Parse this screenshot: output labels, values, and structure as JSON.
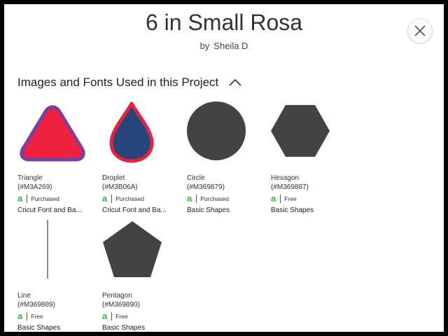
{
  "project": {
    "title": "6 in Small Rosa",
    "by_label": "by",
    "author": "Sheila D"
  },
  "section": {
    "title": "Images and Fonts Used in this Project"
  },
  "icons": {
    "close": "close-icon",
    "collapse": "chevron-up-icon",
    "brand": "cricut-access-icon"
  },
  "colors": {
    "triangle_fill": "#f2203f",
    "triangle_stroke": "#7b3fa0",
    "droplet_fill": "#284579",
    "droplet_stroke": "#e3243b",
    "shape_gray": "#434343",
    "access_green": "#38b24a"
  },
  "items": [
    {
      "name": "Triangle",
      "code": "(#M3A269)",
      "brand": "a",
      "status": "Purchased",
      "category": "Cricut Font and Ba..."
    },
    {
      "name": "Droplet",
      "code": "(#M3B06A)",
      "brand": "a",
      "status": "Purchased",
      "category": "Cricut Font and Ba..."
    },
    {
      "name": "Circle",
      "code": "(#M369879)",
      "brand": "a",
      "status": "Purchased",
      "category": "Basic Shapes"
    },
    {
      "name": "Hexagon",
      "code": "(#M369887)",
      "brand": "a",
      "status": "Free",
      "category": "Basic Shapes"
    },
    {
      "name": "Line",
      "code": "(#M369889)",
      "brand": "a",
      "status": "Free",
      "category": "Basic Shapes"
    },
    {
      "name": "Pentagon",
      "code": "(#M369890)",
      "brand": "a",
      "status": "Free",
      "category": "Basic Shapes"
    }
  ]
}
